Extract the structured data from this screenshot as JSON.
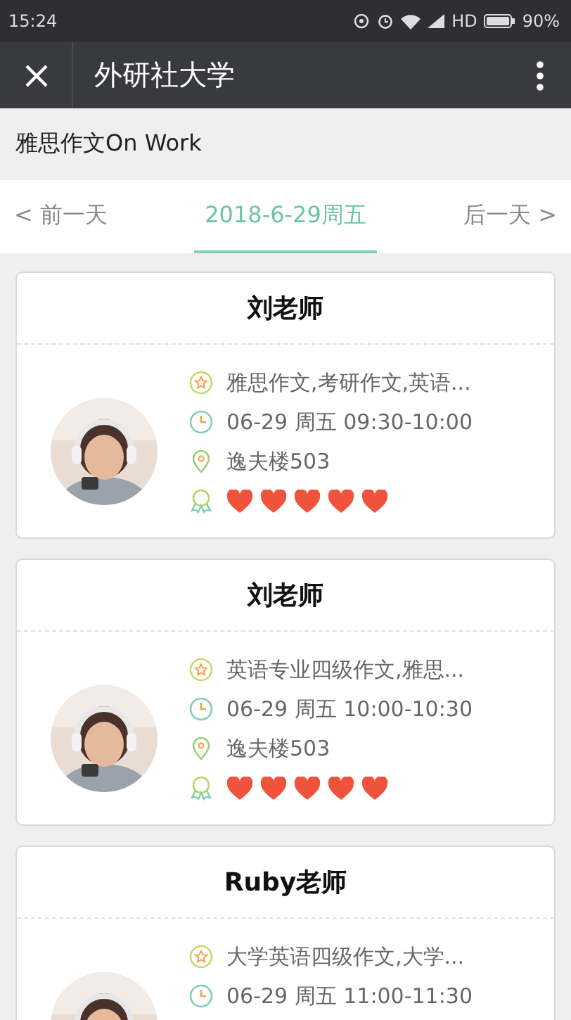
{
  "status_bar": {
    "time": "15:24",
    "network": "HD",
    "battery": "90%"
  },
  "app_bar": {
    "title": "外研社大学"
  },
  "course": {
    "title": "雅思作文On Work"
  },
  "date_nav": {
    "prev": "< 前一天",
    "current": "2018-6-29周五",
    "next": "后一天 >"
  },
  "lessons": [
    {
      "teacher": "刘老师",
      "topics": "雅思作文,考研作文,英语...",
      "time": "06-29 周五 09:30-10:00",
      "place": "逸夫楼503",
      "stars": 5
    },
    {
      "teacher": "刘老师",
      "topics": "英语专业四级作文,雅思...",
      "time": "06-29 周五 10:00-10:30",
      "place": "逸夫楼503",
      "stars": 5
    },
    {
      "teacher": "Ruby老师",
      "topics": "大学英语四级作文,大学...",
      "time": "06-29 周五 11:00-11:30"
    }
  ]
}
